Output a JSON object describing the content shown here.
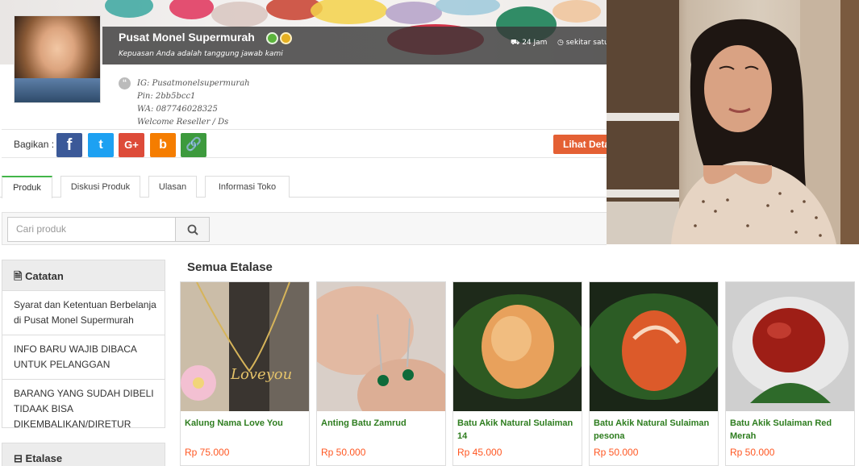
{
  "shop": {
    "name": "Pusat Monel Supermurah",
    "tagline": "Kepuasan Anda adalah tanggung jawab kami",
    "hours": "24 Jam",
    "location_short": "sekitar satu",
    "info_lines": [
      "IG: Pusatmonelsupermurah",
      "Pin: 2bb5bcc1",
      "WA: 087746028325",
      "Welcome Reseller / Ds"
    ]
  },
  "share": {
    "label": "Bagikan :",
    "buttons": [
      {
        "name": "facebook",
        "glyph": "f"
      },
      {
        "name": "twitter",
        "glyph": "t"
      },
      {
        "name": "google-plus",
        "glyph": "G+"
      },
      {
        "name": "blogger",
        "glyph": "b"
      },
      {
        "name": "link",
        "glyph": "🔗"
      }
    ],
    "detail_label": "Lihat Detail"
  },
  "tabs": [
    "Produk",
    "Diskusi Produk",
    "Ulasan",
    "Informasi Toko"
  ],
  "search": {
    "placeholder": "Cari produk"
  },
  "sidebar": {
    "notes_title": "Catatan",
    "notes": [
      "Syarat dan Ketentuan Berbelanja di Pusat Monel Supermurah",
      "INFO BARU WAJIB DIBACA UNTUK PELANGGAN",
      "BARANG YANG SUDAH DIBELI TIDAAK BISA DIKEMBALIKAN/DIRETUR"
    ],
    "etalase_title": "Etalase"
  },
  "section_title": "Semua Etalase",
  "products": [
    {
      "name": "Kalung Nama Love You",
      "price": "Rp 75.000"
    },
    {
      "name": "Anting Batu Zamrud",
      "price": "Rp 50.000"
    },
    {
      "name": "Batu Akik Natural Sulaiman 14",
      "price": "Rp 45.000"
    },
    {
      "name": "Batu Akik Natural Sulaiman pesona",
      "price": "Rp 50.000"
    },
    {
      "name": "Batu Akik Sulaiman Red Merah",
      "price": "Rp 50.000"
    }
  ],
  "colors": {
    "accent_green": "#42b549",
    "price_orange": "#ff5722",
    "detail_button": "#e46034"
  }
}
